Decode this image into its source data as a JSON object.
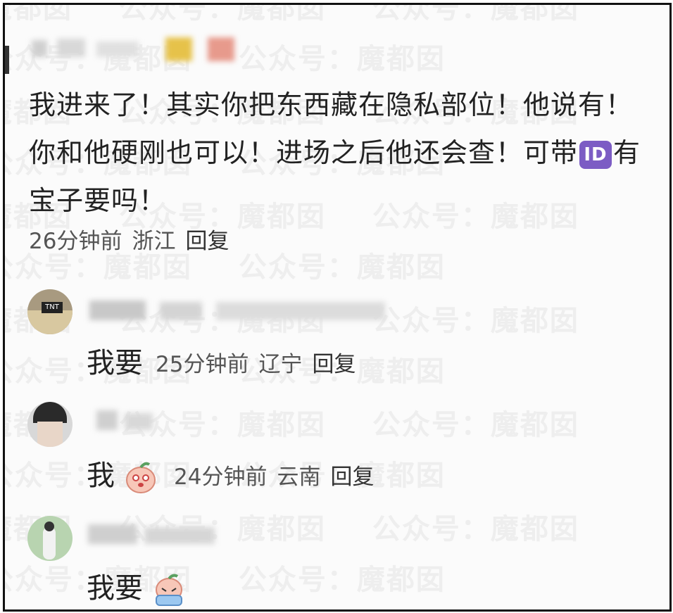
{
  "watermark": "魔都囡  公众号：魔都囡  公众号：魔都囡",
  "main_comment": {
    "text_before_badge": "我进来了！其实你把东西藏在隐私部位！他说有！你和他硬刚也可以！进场之后他还会查！可带",
    "badge": "ID",
    "text_after_badge": "有宝子要吗！",
    "time": "26分钟前",
    "location": "浙江",
    "reply_label": "回复"
  },
  "replies": [
    {
      "text": "我要",
      "time": "25分钟前",
      "location": "辽宁",
      "reply_label": "回复",
      "avatar_label": "TNT"
    },
    {
      "text": "我",
      "time": "24分钟前",
      "location": "云南",
      "reply_label": "回复",
      "sticker": "peach-face-icon"
    },
    {
      "text": "我要",
      "sticker": "crying-peach-icon"
    }
  ],
  "colors": {
    "badge": "#7c5cc4",
    "frame": "#111111",
    "meta": "#555555"
  }
}
